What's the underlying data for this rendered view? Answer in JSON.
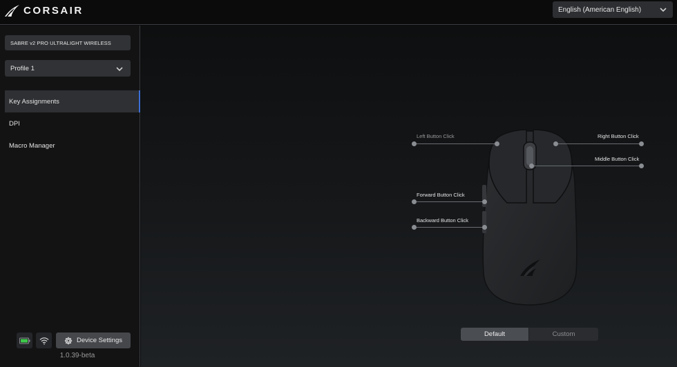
{
  "app": {
    "brand": "CORSAIR"
  },
  "header": {
    "language": "English (American English)"
  },
  "sidebar": {
    "device_name": "SABRE v2 PRO ULTRALIGHT WIRELESS",
    "profile": "Profile 1",
    "items": [
      {
        "label": "Key Assignments",
        "active": true
      },
      {
        "label": "DPI",
        "active": false
      },
      {
        "label": "Macro Manager",
        "active": false
      }
    ],
    "device_settings_label": "Device Settings",
    "version": "1.0.39-beta",
    "battery_color": "#3ec84a"
  },
  "mouse_buttons": {
    "left": "Left Button Click",
    "right": "Right Button Click",
    "middle": "Middle Button Click",
    "forward": "Forward Button Click",
    "backward": "Backward Button Click"
  },
  "mode_toggle": {
    "options": [
      "Default",
      "Custom"
    ],
    "selected": "Default"
  },
  "colors": {
    "accent": "#3c6fd6",
    "background": "#0c0c0c"
  }
}
